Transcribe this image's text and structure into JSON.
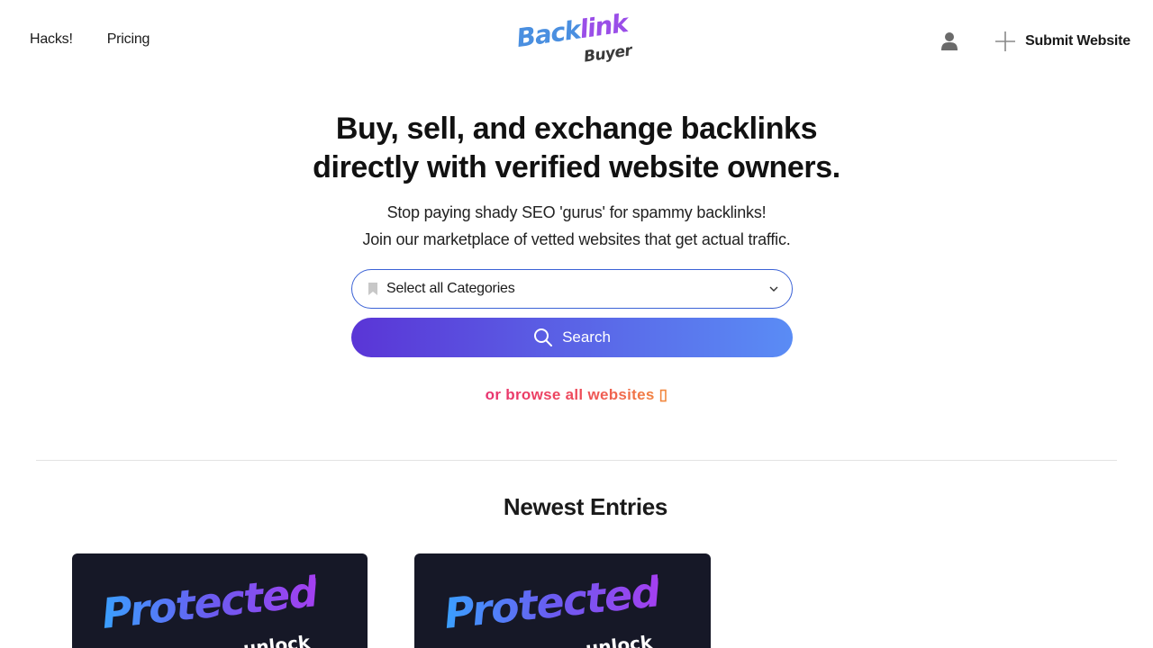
{
  "header": {
    "nav_left": [
      {
        "label": "Hacks!"
      },
      {
        "label": "Pricing"
      }
    ],
    "logo": {
      "line1_a": "Back",
      "line1_b": "link",
      "line2": "Buyer"
    },
    "submit_label": "Submit Website"
  },
  "hero": {
    "title_line1": "Buy, sell, and exchange backlinks",
    "title_line2": "directly with verified website owners.",
    "sub_line1": "Stop paying shady SEO 'gurus' for spammy backlinks!",
    "sub_line2": "Join our marketplace of vetted websites that get actual traffic."
  },
  "search": {
    "category_select_value": "Select all Categories",
    "button_label": "Search",
    "browse_label": "or browse all websites ▯"
  },
  "newest": {
    "title": "Newest Entries",
    "cards": [
      {
        "badge": "Protected",
        "sub": "unlock"
      },
      {
        "badge": "Protected",
        "sub": "unlock"
      }
    ]
  },
  "colors": {
    "accent_blue": "#3b62d6",
    "gradient_start": "#5a35d6",
    "gradient_end": "#5a8cf5",
    "browse_pink": "#e8326f",
    "browse_orange": "#f28a3c",
    "card_bg": "#161827"
  },
  "icons": {
    "user": "user-icon",
    "plus": "plus-icon",
    "bookmark": "bookmark-icon",
    "chevron": "chevron-down-icon",
    "search": "search-icon"
  }
}
